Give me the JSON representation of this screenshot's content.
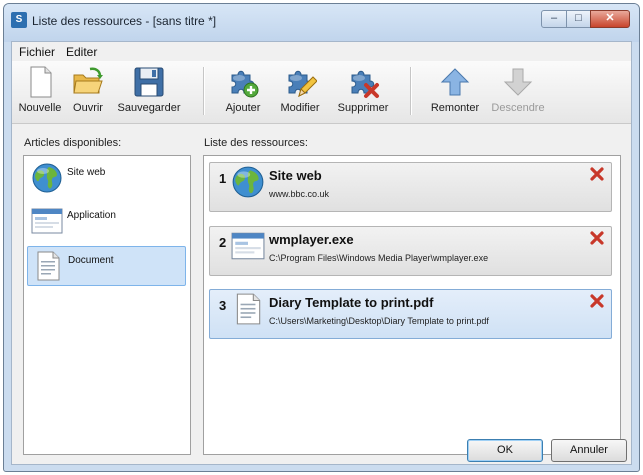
{
  "window": {
    "title": "Liste des ressources - [sans titre *]",
    "app_icon_glyph": "S",
    "minimize_glyph": "–",
    "maximize_glyph": "□",
    "close_glyph": "✕"
  },
  "menu": [
    "Fichier",
    "Editer"
  ],
  "toolbar": {
    "new_label": "Nouvelle",
    "open_label": "Ouvrir",
    "save_label": "Sauvegarder",
    "add_label": "Ajouter",
    "edit_label": "Modifier",
    "delete_label": "Supprimer",
    "up_label": "Remonter",
    "down_label": "Descendre"
  },
  "available": {
    "title": "Articles disponibles:",
    "items": [
      {
        "label": "Site web",
        "icon": "globe-icon",
        "selected": false
      },
      {
        "label": "Application",
        "icon": "application-window-icon",
        "selected": false
      },
      {
        "label": "Document",
        "icon": "document-icon",
        "selected": true
      }
    ]
  },
  "resources": {
    "title": "Liste des ressources:",
    "items": [
      {
        "index": "1",
        "name": "Site web",
        "path": "www.bbc.co.uk",
        "icon": "globe-icon",
        "selected": false
      },
      {
        "index": "2",
        "name": "wmplayer.exe",
        "path": "C:\\Program Files\\Windows Media Player\\wmplayer.exe",
        "icon": "application-window-icon",
        "selected": false
      },
      {
        "index": "3",
        "name": "Diary Template to print.pdf",
        "path": "C:\\Users\\Marketing\\Desktop\\Diary Template to print.pdf",
        "icon": "document-icon",
        "selected": true
      }
    ]
  },
  "buttons": {
    "ok": "OK",
    "cancel": "Annuler"
  },
  "colors": {
    "selection": "#cfe3f8",
    "delete": "#c8382a",
    "puzzle": "#4a7fb8"
  }
}
